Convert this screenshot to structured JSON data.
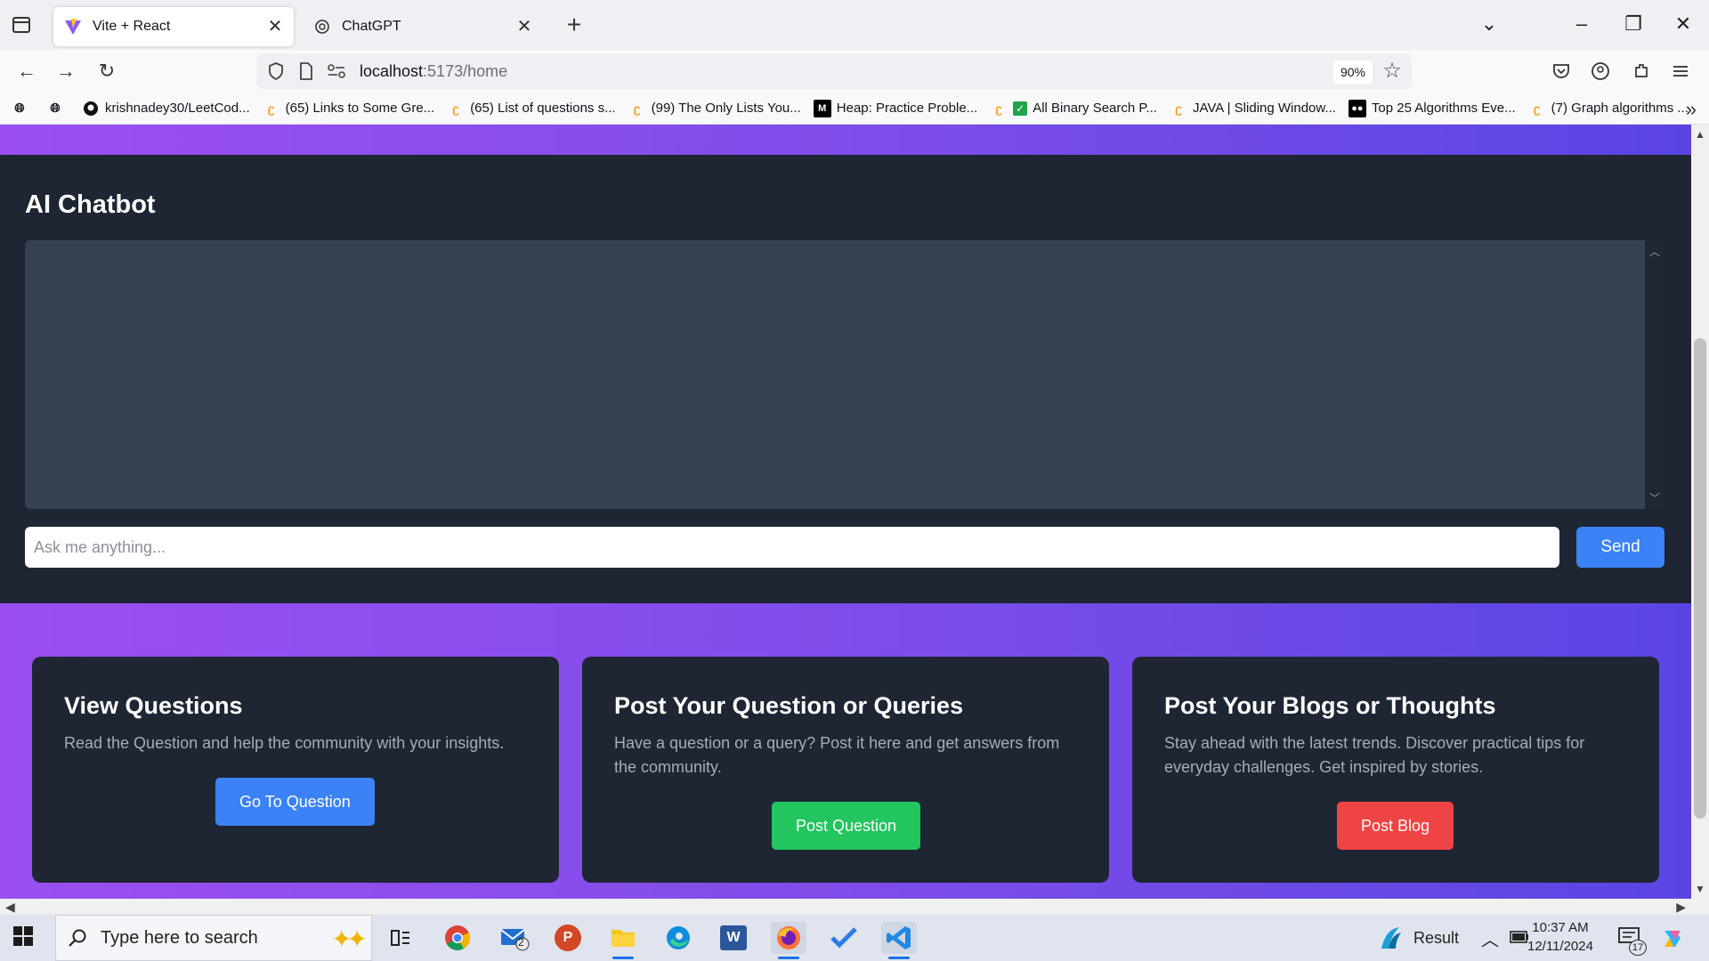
{
  "browser": {
    "tabs": [
      {
        "title": "Vite + React",
        "active": true,
        "icon": "vite-icon"
      },
      {
        "title": "ChatGPT",
        "active": false,
        "icon": "chatgpt-icon"
      }
    ],
    "url_host": "localhost",
    "url_path": ":5173/home",
    "zoom": "90%",
    "bookmarks": [
      {
        "label": "krishnadey30/LeetCod...",
        "icon": "github-icon"
      },
      {
        "label": "(65) Links to Some Gre...",
        "icon": "leetcode-icon"
      },
      {
        "label": "(65) List of questions s...",
        "icon": "leetcode-icon"
      },
      {
        "label": "(99) The Only Lists You...",
        "icon": "leetcode-icon"
      },
      {
        "label": "Heap: Practice Proble...",
        "icon": "medium-icon"
      },
      {
        "label": "All Binary Search P...",
        "icon": "leetcode-check-icon"
      },
      {
        "label": "JAVA | Sliding Window...",
        "icon": "leetcode-icon"
      },
      {
        "label": "Top 25 Algorithms Eve...",
        "icon": "medium-icon"
      },
      {
        "label": "(7) Graph algorithms ...",
        "icon": "leetcode-icon"
      }
    ]
  },
  "chatbot": {
    "title": "AI Chatbot",
    "input_placeholder": "Ask me anything...",
    "input_value": "",
    "send_label": "Send"
  },
  "cards": [
    {
      "title": "View Questions",
      "description": "Read the Question and help the community with your insights.",
      "button": "Go To Question",
      "button_color": "#3b82f6"
    },
    {
      "title": "Post Your Question or Queries",
      "description": "Have a question or a query? Post it here and get answers from the community.",
      "button": "Post Question",
      "button_color": "#22c55e"
    },
    {
      "title": "Post Your Blogs or Thoughts",
      "description": "Stay ahead with the latest trends. Discover practical tips for everyday challenges. Get inspired by stories.",
      "button": "Post Blog",
      "button_color": "#ef4444"
    }
  ],
  "taskbar": {
    "search_placeholder": "Type here to search",
    "mail_badge": "2",
    "weather_label": "Result",
    "time": "10:37 AM",
    "date": "12/11/2024",
    "notification_count": "17"
  }
}
